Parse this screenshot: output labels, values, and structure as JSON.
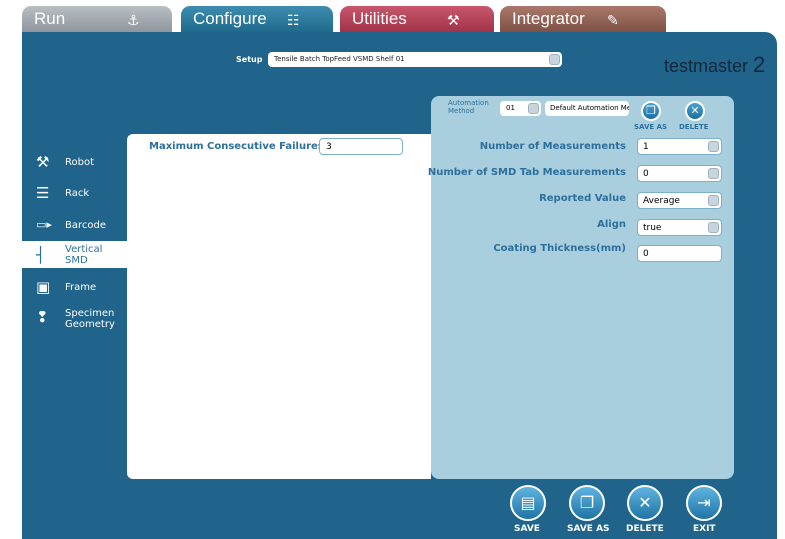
{
  "tabs": [
    {
      "label": "Run",
      "icon": "robot-arm-icon"
    },
    {
      "label": "Configure",
      "icon": "hierarchy-icon"
    },
    {
      "label": "Utilities",
      "icon": "tools-icon"
    },
    {
      "label": "Integrator",
      "icon": "pencil-icon"
    }
  ],
  "header": {
    "setup_label": "Setup",
    "setup_value": "Tensile Batch TopFeed VSMD Shelf 01",
    "brand": "testmaster",
    "brand_num": "2"
  },
  "sidebar": {
    "items": [
      {
        "label": "Robot",
        "icon": "robot-icon"
      },
      {
        "label": "Rack",
        "icon": "rack-icon"
      },
      {
        "label": "Barcode",
        "icon": "barcode-icon"
      },
      {
        "label": "Vertical SMD",
        "icon": "vertical-smd-icon",
        "selected": true
      },
      {
        "label": "Frame",
        "icon": "frame-icon"
      },
      {
        "label": "Specimen Geometry",
        "icon": "specimen-icon"
      }
    ]
  },
  "content": {
    "max_failures_label": "Maximum Consecutive Failures",
    "max_failures_value": "3"
  },
  "automation": {
    "label_line1": "Automation",
    "label_line2": "Method",
    "number": "01",
    "method_name": "Default Automation Method",
    "save_as": "SAVE AS",
    "delete": "DELETE"
  },
  "fields": [
    {
      "label": "Number of Measurements",
      "value": "1",
      "dropdown": true
    },
    {
      "label": "Number of SMD Tab Measurements",
      "value": "0",
      "dropdown": true
    },
    {
      "label": "Reported Value",
      "value": "Average",
      "dropdown": true
    },
    {
      "label": "Align",
      "value": "true",
      "dropdown": true
    },
    {
      "label": "Coating Thickness(mm)",
      "value": "0",
      "dropdown": false
    }
  ],
  "bottom": {
    "save": "SAVE",
    "save_as": "SAVE AS",
    "delete": "DELETE",
    "exit": "EXIT"
  },
  "colors": {
    "primary": "#20648c",
    "panel": "#a9cfdf",
    "configure_tab": "#2a7aa0",
    "utilities_tab": "#b3425a",
    "integrator_tab": "#8f6152",
    "run_tab": "#a4aab0"
  }
}
